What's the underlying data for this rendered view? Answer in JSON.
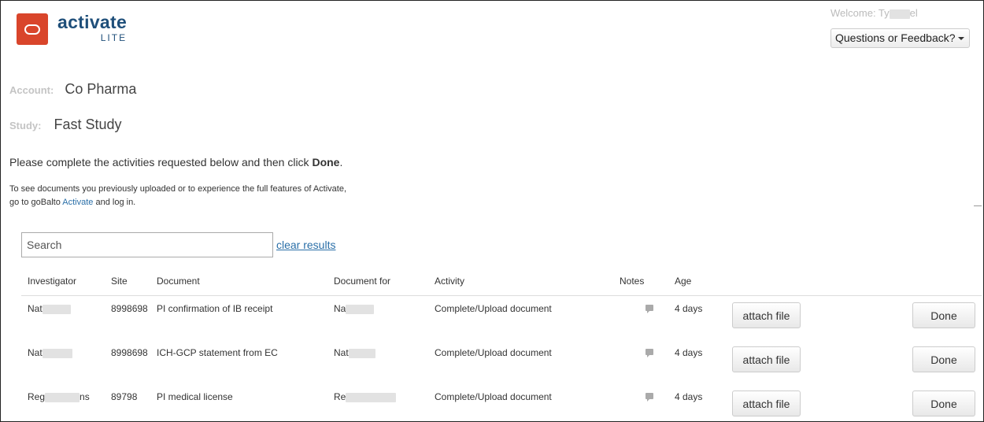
{
  "header": {
    "logo_title": "activate",
    "logo_sub": "LITE",
    "welcome_prefix": "Welcome: Ty",
    "welcome_suffix": "el",
    "feedback_label": "Questions or Feedback?"
  },
  "account": {
    "label": "Account:",
    "value": "Co Pharma"
  },
  "study": {
    "label": "Study:",
    "value": "Fast Study"
  },
  "instructions": {
    "main_prefix": "Please complete the activities requested below and then click ",
    "main_bold": "Done",
    "main_suffix": ".",
    "line1": "To see documents you previously uploaded or to experience the full features of Activate,",
    "line2_prefix": "go to goBalto ",
    "line2_link": "Activate",
    "line2_suffix": " and log in."
  },
  "search": {
    "placeholder": "Search",
    "clear_label": "clear results"
  },
  "table": {
    "headers": {
      "investigator": "Investigator",
      "site": "Site",
      "document": "Document",
      "document_for": "Document for",
      "activity": "Activity",
      "notes": "Notes",
      "age": "Age"
    },
    "rows": [
      {
        "investigator": "Nat",
        "site": "8998698",
        "document": "PI confirmation of IB receipt",
        "document_for": "Na",
        "activity": "Complete/Upload document",
        "age": "4 days",
        "attach_label": "attach file",
        "done_label": "Done"
      },
      {
        "investigator": "Nat",
        "site": "8998698",
        "document": "ICH-GCP statement from EC",
        "document_for": "Nat",
        "activity": "Complete/Upload document",
        "age": "4 days",
        "attach_label": "attach file",
        "done_label": "Done"
      },
      {
        "investigator": "Reg",
        "investigator_suffix": "ns",
        "site": "89798",
        "document": "PI medical license",
        "document_for": "Re",
        "activity": "Complete/Upload document",
        "age": "4 days",
        "attach_label": "attach file",
        "done_label": "Done"
      }
    ]
  }
}
